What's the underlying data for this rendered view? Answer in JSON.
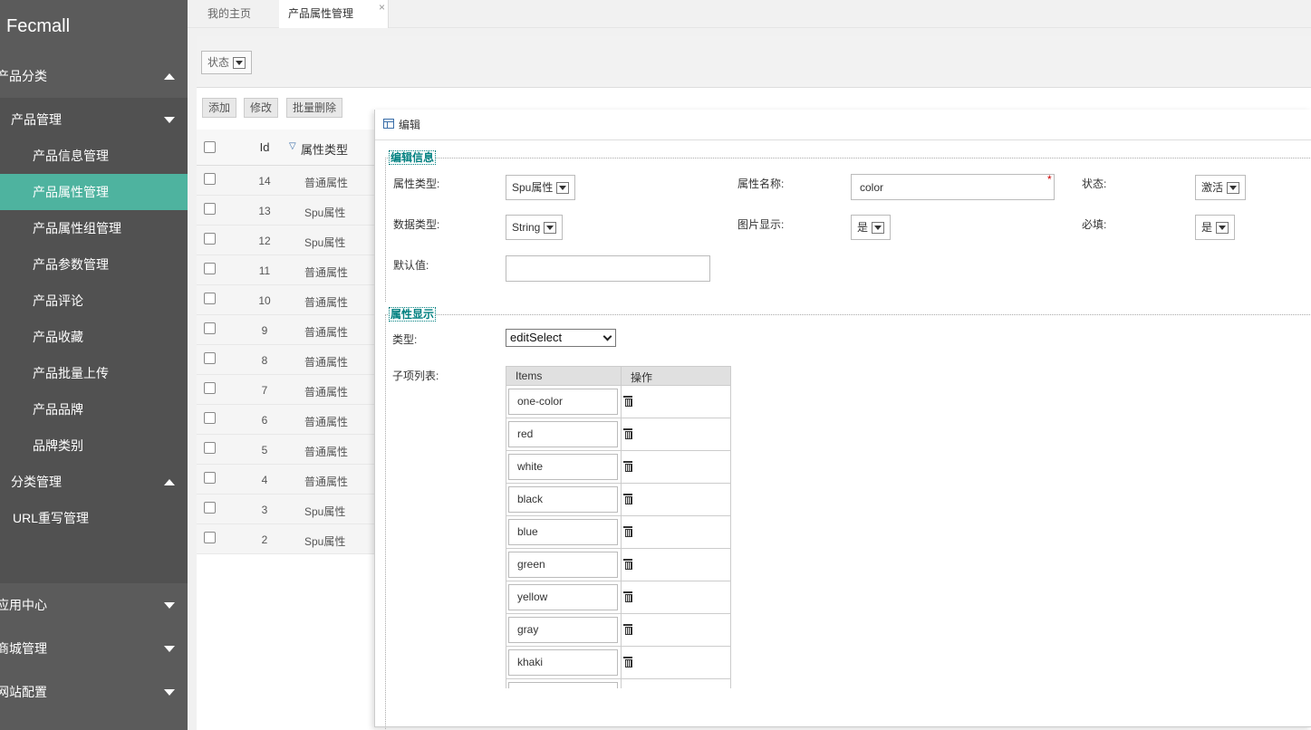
{
  "app": {
    "logo": "Fecmall"
  },
  "sidebar": {
    "top": {
      "label": "产品分类"
    },
    "product_mgmt": {
      "label": "产品管理"
    },
    "items": [
      {
        "label": "产品信息管理"
      },
      {
        "label": "产品属性管理",
        "active": true
      },
      {
        "label": "产品属性组管理"
      },
      {
        "label": "产品参数管理"
      },
      {
        "label": "产品评论"
      },
      {
        "label": "产品收藏"
      },
      {
        "label": "产品批量上传"
      },
      {
        "label": "产品品牌"
      },
      {
        "label": "品牌类别"
      }
    ],
    "category_mgmt": {
      "label": "分类管理"
    },
    "url_rewrite": {
      "label": "URL重写管理"
    },
    "bottom": [
      {
        "label": "应用中心"
      },
      {
        "label": "商城管理"
      },
      {
        "label": "网站配置"
      }
    ]
  },
  "tabs": {
    "home": "我的主页",
    "current": "产品属性管理",
    "close": "×"
  },
  "filter": {
    "status_label": "状态"
  },
  "toolbar": {
    "add": "添加",
    "edit": "修改",
    "batch_delete": "批量删除"
  },
  "grid": {
    "headers": {
      "id": "Id",
      "type": "属性类型",
      "sort_icon": "▽"
    },
    "rows": [
      {
        "id": "14",
        "type": "普通属性"
      },
      {
        "id": "13",
        "type": "Spu属性"
      },
      {
        "id": "12",
        "type": "Spu属性"
      },
      {
        "id": "11",
        "type": "普通属性"
      },
      {
        "id": "10",
        "type": "普通属性"
      },
      {
        "id": "9",
        "type": "普通属性"
      },
      {
        "id": "8",
        "type": "普通属性"
      },
      {
        "id": "7",
        "type": "普通属性"
      },
      {
        "id": "6",
        "type": "普通属性"
      },
      {
        "id": "5",
        "type": "普通属性"
      },
      {
        "id": "4",
        "type": "普通属性"
      },
      {
        "id": "3",
        "type": "Spu属性"
      },
      {
        "id": "2",
        "type": "Spu属性"
      }
    ]
  },
  "dialog": {
    "title": "编辑",
    "edit_info": {
      "legend": "编辑信息",
      "attr_type_label": "属性类型:",
      "attr_type_value": "Spu属性",
      "attr_name_label": "属性名称:",
      "attr_name_value": "color",
      "required_mark": "*",
      "status_label": "状态:",
      "status_value": "激活",
      "data_type_label": "数据类型:",
      "data_type_value": "String",
      "image_display_label": "图片显示:",
      "image_display_value": "是",
      "required_label": "必填:",
      "required_value": "是",
      "default_label": "默认值:",
      "default_value": ""
    },
    "attr_display": {
      "legend": "属性显示",
      "type_label": "类型:",
      "type_value": "editSelect",
      "sublist_label": "子项列表:",
      "col_items": "Items",
      "col_ops": "操作",
      "items": [
        "one-color",
        "red",
        "white",
        "black",
        "blue",
        "green",
        "yellow",
        "gray",
        "khaki"
      ]
    }
  },
  "colors": {
    "sidebar": "#5b5b5b",
    "active": "#4eb39f",
    "legend": "#008080"
  }
}
